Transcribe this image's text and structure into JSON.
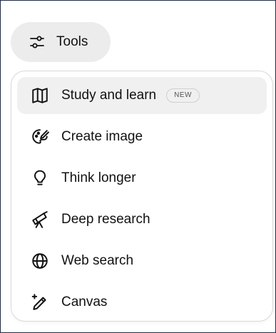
{
  "tools_button": {
    "label": "Tools",
    "icon": "sliders-icon"
  },
  "menu": {
    "items": [
      {
        "label": "Study and learn",
        "icon": "book-open-icon",
        "badge": "NEW",
        "highlighted": true
      },
      {
        "label": "Create image",
        "icon": "palette-brush-icon"
      },
      {
        "label": "Think longer",
        "icon": "lightbulb-icon"
      },
      {
        "label": "Deep research",
        "icon": "telescope-icon"
      },
      {
        "label": "Web search",
        "icon": "globe-icon"
      },
      {
        "label": "Canvas",
        "icon": "pen-sparkle-icon"
      }
    ]
  },
  "colors": {
    "frame_border": "#1f2a44",
    "pill_bg": "#ececec",
    "highlight_bg": "#f0f0f0",
    "menu_border": "#d9d9d9",
    "text": "#111111"
  }
}
